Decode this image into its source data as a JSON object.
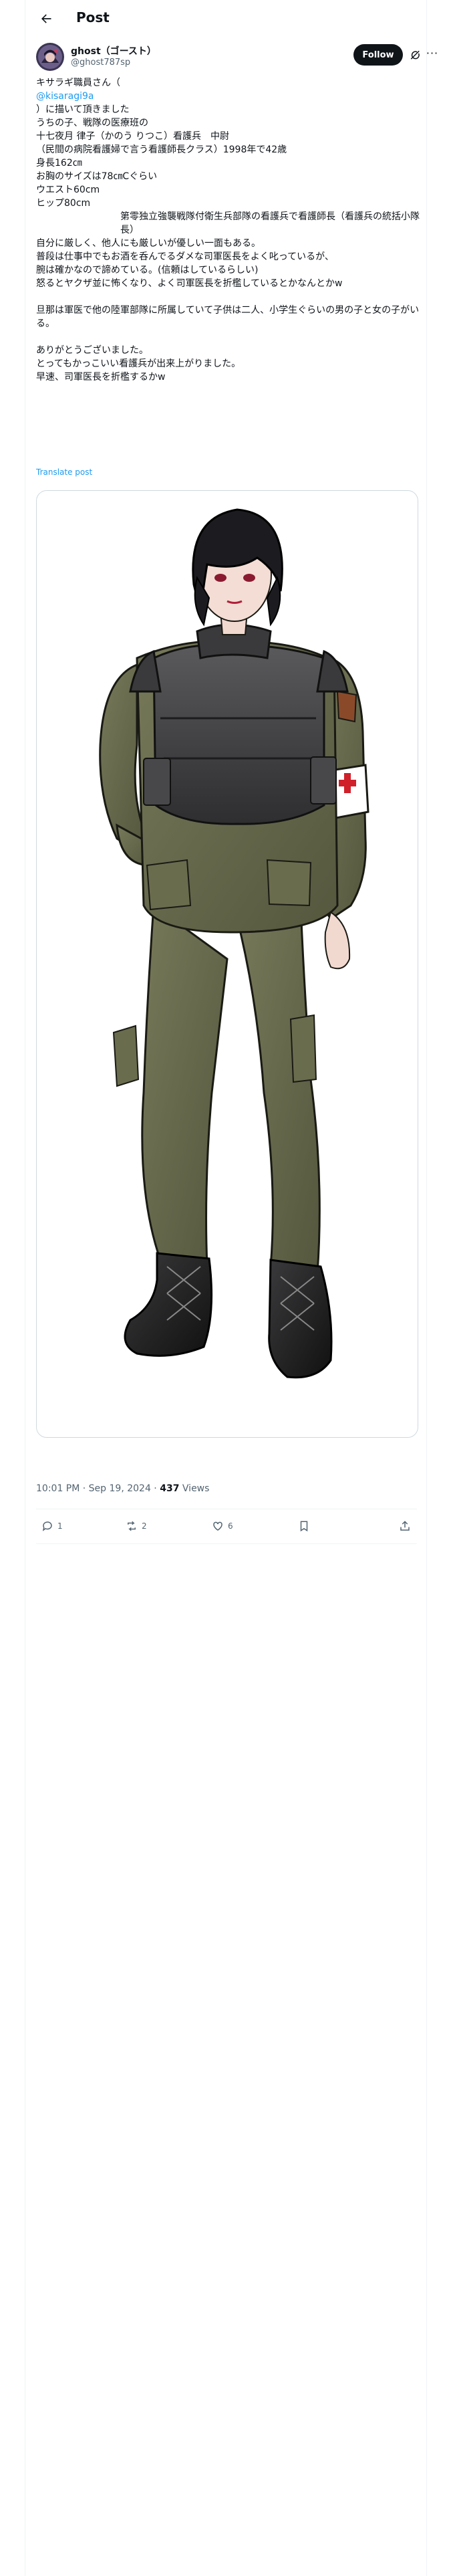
{
  "topbar": {
    "title": "Post",
    "back_icon": "arrow-left-icon"
  },
  "author": {
    "name": "ghost（ゴースト）",
    "handle": "@ghost787sp",
    "follow_label": "Follow"
  },
  "tweet": {
    "lines": [
      "キサラギ職員さん（",
      "@kisaragi9a",
      "）に描いて頂きました",
      "うちの子、戦隊の医療班の",
      "十七夜月 律子（かのう りつこ）看護兵　中尉",
      "（民間の病院看護婦で言う看護師長クラス）1998年で42歳",
      "身長162㎝",
      "お胸のサイズは78㎝Cぐらい",
      "ウエスト60cm",
      "ヒップ80cm",
      "第零独立強襲戦隊付衛生兵部隊の看護兵で看護師長（看護兵の統括小隊長）",
      "自分に厳しく、他人にも厳しいが優しい一面もある。",
      "普段は仕事中でもお酒を呑んでるダメな司軍医長をよく叱っているが、",
      "腕は確かなので諦めている。(信頼はしているらしい)",
      "怒るとヤクザ並に怖くなり、よく司軍医長を折檻しているとかなんとかw",
      "旦那は軍医で他の陸軍部隊に所属していて子供は二人、小学生ぐらいの男の子と女の子がいる。",
      "ありがとうございました。",
      "とってもかっこいい看護兵が出来上がりました。",
      "早速、司軍医長を折檻するかw"
    ],
    "translate_label": "Translate post"
  },
  "media": {
    "alt": "Illustration of a female army medic in olive-green uniform with black body armor and red-cross armband"
  },
  "meta": {
    "time": "10:01 PM · Sep 19, 2024",
    "separator": " · ",
    "views_count": "437",
    "views_label": " Views"
  },
  "actions": {
    "replies": "1",
    "reposts": "2",
    "likes": "6",
    "bookmarks": "",
    "share": ""
  },
  "colors": {
    "accent": "#1d9bf0",
    "text": "#0f1419",
    "muted": "#536471",
    "border": "#eff3f4"
  }
}
